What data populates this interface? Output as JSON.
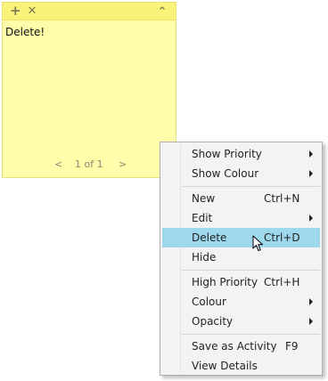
{
  "note": {
    "add_icon": "+",
    "close_icon": "✕",
    "collapse_icon": "⌃",
    "text": "Delete!",
    "pager": {
      "prev": "<",
      "label": "1 of 1",
      "next": ">"
    }
  },
  "menu": {
    "items": [
      {
        "label": "Show Priority",
        "shortcut": "",
        "submenu": true
      },
      {
        "label": "Show Colour",
        "shortcut": "",
        "submenu": true
      },
      {
        "label": "New",
        "shortcut": "Ctrl+N",
        "submenu": false
      },
      {
        "label": "Edit",
        "shortcut": "",
        "submenu": true
      },
      {
        "label": "Delete",
        "shortcut": "Ctrl+D",
        "submenu": false,
        "highlighted": true
      },
      {
        "label": "Hide",
        "shortcut": "",
        "submenu": false
      },
      {
        "label": "High Priority",
        "shortcut": "Ctrl+H",
        "submenu": false
      },
      {
        "label": "Colour",
        "shortcut": "",
        "submenu": true
      },
      {
        "label": "Opacity",
        "shortcut": "",
        "submenu": true
      },
      {
        "label": "Save as Activity",
        "shortcut": "F9",
        "submenu": false
      },
      {
        "label": "View Details",
        "shortcut": "",
        "submenu": false
      }
    ]
  },
  "colors": {
    "note_bg": "#fefdaa",
    "note_bar": "#f9f37a",
    "menu_bg": "#f3f3f3",
    "highlight": "#9dd8ed"
  }
}
